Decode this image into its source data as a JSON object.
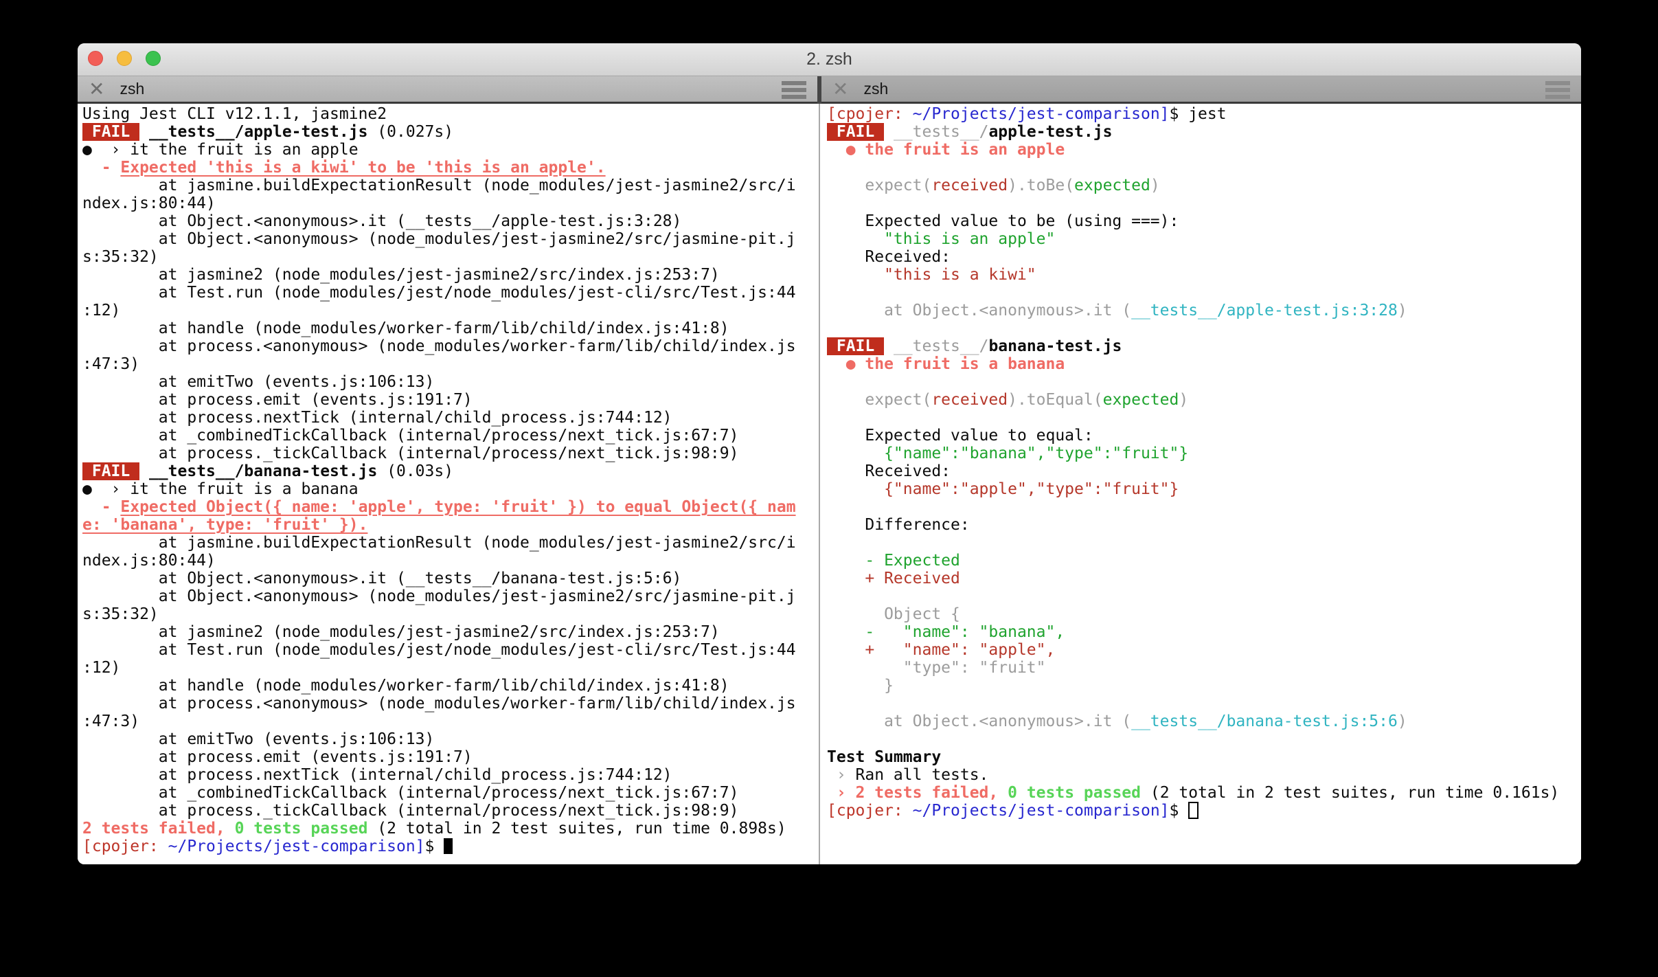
{
  "window": {
    "title": "2. zsh"
  },
  "icons": {
    "close_tab": "✕",
    "hamburger": "menu",
    "traffic_lights": [
      "close",
      "minimize",
      "zoom"
    ]
  },
  "colors": {
    "badge_bg": "#c02d1d",
    "salmon": "#ef6b64",
    "bright_green": "#57d457",
    "brick": "#b5372a",
    "green": "#1fa32e",
    "cyan": "#30b4c1",
    "blue": "#2727cf",
    "prompt_red": "#bd3529",
    "dim": "#9c9c9c"
  },
  "left_pane": {
    "tab_title": "zsh",
    "cursor": "block",
    "lines": [
      {
        "s": [
          [
            "Using Jest CLI v12.1.1, jasmine2",
            "d"
          ]
        ]
      },
      {
        "s": [
          [
            " FAIL ",
            "bg"
          ],
          [
            " ",
            "d"
          ],
          [
            "__tests__/apple-test.js",
            "b"
          ],
          [
            " (0.027s)",
            "d"
          ]
        ]
      },
      {
        "s": [
          [
            "●  › it the fruit is an apple",
            "d"
          ]
        ]
      },
      {
        "s": [
          [
            "  - ",
            "sa"
          ],
          [
            "Expected 'this is a kiwi' to be 'this is an apple'.",
            "su"
          ]
        ]
      },
      {
        "s": [
          [
            "        at jasmine.buildExpectationResult (node_modules/jest-jasmine2/src/i",
            "d"
          ]
        ]
      },
      {
        "s": [
          [
            "ndex.js:80:44)",
            "d"
          ]
        ]
      },
      {
        "s": [
          [
            "        at Object.<anonymous>.it (__tests__/apple-test.js:3:28)",
            "d"
          ]
        ]
      },
      {
        "s": [
          [
            "        at Object.<anonymous> (node_modules/jest-jasmine2/src/jasmine-pit.j",
            "d"
          ]
        ]
      },
      {
        "s": [
          [
            "s:35:32)",
            "d"
          ]
        ]
      },
      {
        "s": [
          [
            "        at jasmine2 (node_modules/jest-jasmine2/src/index.js:253:7)",
            "d"
          ]
        ]
      },
      {
        "s": [
          [
            "        at Test.run (node_modules/jest/node_modules/jest-cli/src/Test.js:44",
            "d"
          ]
        ]
      },
      {
        "s": [
          [
            ":12)",
            "d"
          ]
        ]
      },
      {
        "s": [
          [
            "        at handle (node_modules/worker-farm/lib/child/index.js:41:8)",
            "d"
          ]
        ]
      },
      {
        "s": [
          [
            "        at process.<anonymous> (node_modules/worker-farm/lib/child/index.js",
            "d"
          ]
        ]
      },
      {
        "s": [
          [
            ":47:3)",
            "d"
          ]
        ]
      },
      {
        "s": [
          [
            "        at emitTwo (events.js:106:13)",
            "d"
          ]
        ]
      },
      {
        "s": [
          [
            "        at process.emit (events.js:191:7)",
            "d"
          ]
        ]
      },
      {
        "s": [
          [
            "        at process.nextTick (internal/child_process.js:744:12)",
            "d"
          ]
        ]
      },
      {
        "s": [
          [
            "        at _combinedTickCallback (internal/process/next_tick.js:67:7)",
            "d"
          ]
        ]
      },
      {
        "s": [
          [
            "        at process._tickCallback (internal/process/next_tick.js:98:9)",
            "d"
          ]
        ]
      },
      {
        "s": [
          [
            " FAIL ",
            "bg"
          ],
          [
            " ",
            "d"
          ],
          [
            "__tests__/banana-test.js",
            "b"
          ],
          [
            " (0.03s)",
            "d"
          ]
        ]
      },
      {
        "s": [
          [
            "●  › it the fruit is a banana",
            "d"
          ]
        ]
      },
      {
        "s": [
          [
            "  - ",
            "sa"
          ],
          [
            "Expected Object({ name: 'apple', type: 'fruit' }) to equal Object({ nam",
            "su"
          ]
        ]
      },
      {
        "s": [
          [
            "e: 'banana', type: 'fruit' }).",
            "su"
          ]
        ]
      },
      {
        "s": [
          [
            "        at jasmine.buildExpectationResult (node_modules/jest-jasmine2/src/i",
            "d"
          ]
        ]
      },
      {
        "s": [
          [
            "ndex.js:80:44)",
            "d"
          ]
        ]
      },
      {
        "s": [
          [
            "        at Object.<anonymous>.it (__tests__/banana-test.js:5:6)",
            "d"
          ]
        ]
      },
      {
        "s": [
          [
            "        at Object.<anonymous> (node_modules/jest-jasmine2/src/jasmine-pit.j",
            "d"
          ]
        ]
      },
      {
        "s": [
          [
            "s:35:32)",
            "d"
          ]
        ]
      },
      {
        "s": [
          [
            "        at jasmine2 (node_modules/jest-jasmine2/src/index.js:253:7)",
            "d"
          ]
        ]
      },
      {
        "s": [
          [
            "        at Test.run (node_modules/jest/node_modules/jest-cli/src/Test.js:44",
            "d"
          ]
        ]
      },
      {
        "s": [
          [
            ":12)",
            "d"
          ]
        ]
      },
      {
        "s": [
          [
            "        at handle (node_modules/worker-farm/lib/child/index.js:41:8)",
            "d"
          ]
        ]
      },
      {
        "s": [
          [
            "        at process.<anonymous> (node_modules/worker-farm/lib/child/index.js",
            "d"
          ]
        ]
      },
      {
        "s": [
          [
            ":47:3)",
            "d"
          ]
        ]
      },
      {
        "s": [
          [
            "        at emitTwo (events.js:106:13)",
            "d"
          ]
        ]
      },
      {
        "s": [
          [
            "        at process.emit (events.js:191:7)",
            "d"
          ]
        ]
      },
      {
        "s": [
          [
            "        at process.nextTick (internal/child_process.js:744:12)",
            "d"
          ]
        ]
      },
      {
        "s": [
          [
            "        at _combinedTickCallback (internal/process/next_tick.js:67:7)",
            "d"
          ]
        ]
      },
      {
        "s": [
          [
            "        at process._tickCallback (internal/process/next_tick.js:98:9)",
            "d"
          ]
        ]
      },
      {
        "s": [
          [
            "2 tests failed,",
            "sa"
          ],
          [
            " ",
            "d"
          ],
          [
            "0 tests passed",
            "bgr"
          ],
          [
            " (2 total in 2 test suites, run time 0.898s)",
            "d"
          ]
        ]
      },
      {
        "s": [
          [
            "[cpojer:",
            "pr"
          ],
          [
            " ",
            "d"
          ],
          [
            "~/Projects/jest-comparison]",
            "bl"
          ],
          [
            "$ ",
            "d"
          ]
        ],
        "cursor": "block"
      }
    ]
  },
  "right_pane": {
    "tab_title": "zsh",
    "cursor": "hollow",
    "lines": [
      {
        "s": [
          [
            "[cpojer:",
            "pr"
          ],
          [
            " ",
            "d"
          ],
          [
            "~/Projects/jest-comparison]",
            "bl"
          ],
          [
            "$ jest",
            "d"
          ]
        ]
      },
      {
        "s": [
          [
            " FAIL ",
            "bg"
          ],
          [
            " ",
            "d"
          ],
          [
            "__tests__/",
            "dm"
          ],
          [
            "apple-test.js",
            "b"
          ]
        ]
      },
      {
        "s": [
          [
            "  ",
            "d"
          ],
          [
            "● the fruit is an apple",
            "sa"
          ]
        ]
      },
      {
        "s": []
      },
      {
        "s": [
          [
            "    expect(",
            "dm"
          ],
          [
            "received",
            "br"
          ],
          [
            ").toBe(",
            "dm"
          ],
          [
            "expected",
            "gr"
          ],
          [
            ")",
            "dm"
          ]
        ]
      },
      {
        "s": []
      },
      {
        "s": [
          [
            "    Expected value to be (using ===):",
            "d"
          ]
        ]
      },
      {
        "s": [
          [
            "      \"this is an apple\"",
            "gr"
          ]
        ]
      },
      {
        "s": [
          [
            "    Received:",
            "d"
          ]
        ]
      },
      {
        "s": [
          [
            "      \"this is a kiwi\"",
            "br"
          ]
        ]
      },
      {
        "s": []
      },
      {
        "s": [
          [
            "      at Object.<anonymous>.it (",
            "dm"
          ],
          [
            "__tests__/apple-test.js:3:28",
            "cy"
          ],
          [
            ")",
            "dm"
          ]
        ]
      },
      {
        "s": []
      },
      {
        "s": [
          [
            " FAIL ",
            "bg"
          ],
          [
            " ",
            "d"
          ],
          [
            "__tests__/",
            "dm"
          ],
          [
            "banana-test.js",
            "b"
          ]
        ]
      },
      {
        "s": [
          [
            "  ",
            "d"
          ],
          [
            "● the fruit is a banana",
            "sa"
          ]
        ]
      },
      {
        "s": []
      },
      {
        "s": [
          [
            "    expect(",
            "dm"
          ],
          [
            "received",
            "br"
          ],
          [
            ").toEqual(",
            "dm"
          ],
          [
            "expected",
            "gr"
          ],
          [
            ")",
            "dm"
          ]
        ]
      },
      {
        "s": []
      },
      {
        "s": [
          [
            "    Expected value to equal:",
            "d"
          ]
        ]
      },
      {
        "s": [
          [
            "      {\"name\":\"banana\",\"type\":\"fruit\"}",
            "gr"
          ]
        ]
      },
      {
        "s": [
          [
            "    Received:",
            "d"
          ]
        ]
      },
      {
        "s": [
          [
            "      {\"name\":\"apple\",\"type\":\"fruit\"}",
            "br"
          ]
        ]
      },
      {
        "s": []
      },
      {
        "s": [
          [
            "    Difference:",
            "d"
          ]
        ]
      },
      {
        "s": []
      },
      {
        "s": [
          [
            "    - Expected",
            "gr"
          ]
        ]
      },
      {
        "s": [
          [
            "    + Received",
            "br"
          ]
        ]
      },
      {
        "s": []
      },
      {
        "s": [
          [
            "      Object {",
            "dm"
          ]
        ]
      },
      {
        "s": [
          [
            "    -   \"name\": \"banana\",",
            "gr"
          ]
        ]
      },
      {
        "s": [
          [
            "    +   \"name\": \"apple\",",
            "br"
          ]
        ]
      },
      {
        "s": [
          [
            "        \"type\": \"fruit\"",
            "dm"
          ]
        ]
      },
      {
        "s": [
          [
            "      }",
            "dm"
          ]
        ]
      },
      {
        "s": []
      },
      {
        "s": [
          [
            "      at Object.<anonymous>.it (",
            "dm"
          ],
          [
            "__tests__/banana-test.js:5:6",
            "cy"
          ],
          [
            ")",
            "dm"
          ]
        ]
      },
      {
        "s": []
      },
      {
        "s": [
          [
            "Test Summary",
            "b"
          ]
        ]
      },
      {
        "s": [
          [
            " › ",
            "dm"
          ],
          [
            "Ran all tests.",
            "d"
          ]
        ]
      },
      {
        "s": [
          [
            " › ",
            "sa"
          ],
          [
            "2 tests failed,",
            "sa"
          ],
          [
            " ",
            "d"
          ],
          [
            "0 tests passed",
            "bgr"
          ],
          [
            " (2 total in 2 test suites, run time 0.161s)",
            "d"
          ]
        ]
      },
      {
        "s": [
          [
            "[cpojer:",
            "pr"
          ],
          [
            " ",
            "d"
          ],
          [
            "~/Projects/jest-comparison]",
            "bl"
          ],
          [
            "$ ",
            "d"
          ]
        ],
        "cursor": "hollow"
      }
    ]
  }
}
